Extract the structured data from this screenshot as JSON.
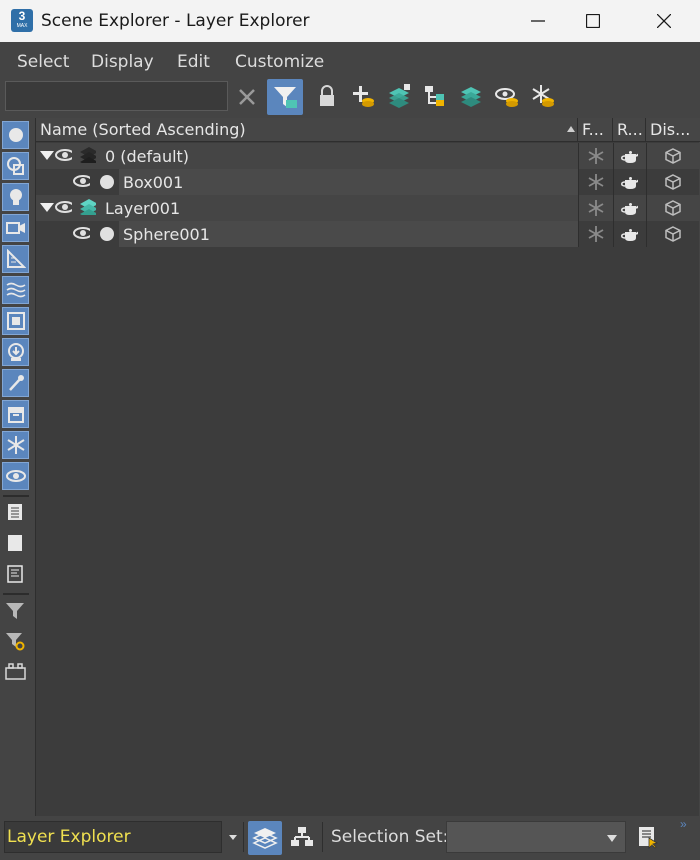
{
  "window": {
    "title": "Scene Explorer - Layer Explorer",
    "app_icon_number": "3",
    "app_icon_text": "MAX",
    "minimize_icon": "minimize-icon",
    "maximize_icon": "maximize-icon",
    "close_icon": "close-icon"
  },
  "menu": {
    "items": [
      "Select",
      "Display",
      "Edit",
      "Customize"
    ]
  },
  "toolbar": {
    "search_value": "",
    "search_placeholder": "",
    "icons": [
      "clear-x-icon",
      "filter-active-icon",
      "lock-icon",
      "add-to-layer-icon",
      "new-layer-icon",
      "hierarchy-icon",
      "layers-icon",
      "hide-layer-icon",
      "freeze-layer-icon"
    ]
  },
  "sidebar": {
    "filter_icons": [
      "geometry-icon",
      "shapes-icon",
      "lights-icon",
      "cameras-icon",
      "helpers-icon",
      "space-warps-icon",
      "groups-icon",
      "xrefs-icon",
      "bones-icon",
      "containers-icon",
      "frozen-icon",
      "hidden-icon"
    ],
    "tool_icons": [
      "display-all-icon",
      "display-none-icon",
      "invert-display-icon",
      "filter-icon",
      "filter-settings-icon",
      "plugin-icon"
    ]
  },
  "columns": {
    "name": "Name (Sorted Ascending)",
    "frozen": "F...",
    "renderable": "R...",
    "display": "Dis..."
  },
  "rows": [
    {
      "name": "0 (default)",
      "type": "layer",
      "expanded": true,
      "level": 0
    },
    {
      "name": "Box001",
      "type": "object",
      "level": 1
    },
    {
      "name": "Layer001",
      "type": "layer",
      "expanded": true,
      "level": 0
    },
    {
      "name": "Sphere001",
      "type": "object",
      "level": 1
    }
  ],
  "bottom": {
    "mode": "Layer Explorer",
    "selection_set_label": "Selection Set:",
    "selection_set_value": ""
  },
  "colors": {
    "accent": "#5b86bd",
    "mode_text": "#f0e050",
    "layer_icon_active": "#4fc4b4",
    "background": "#444444"
  }
}
